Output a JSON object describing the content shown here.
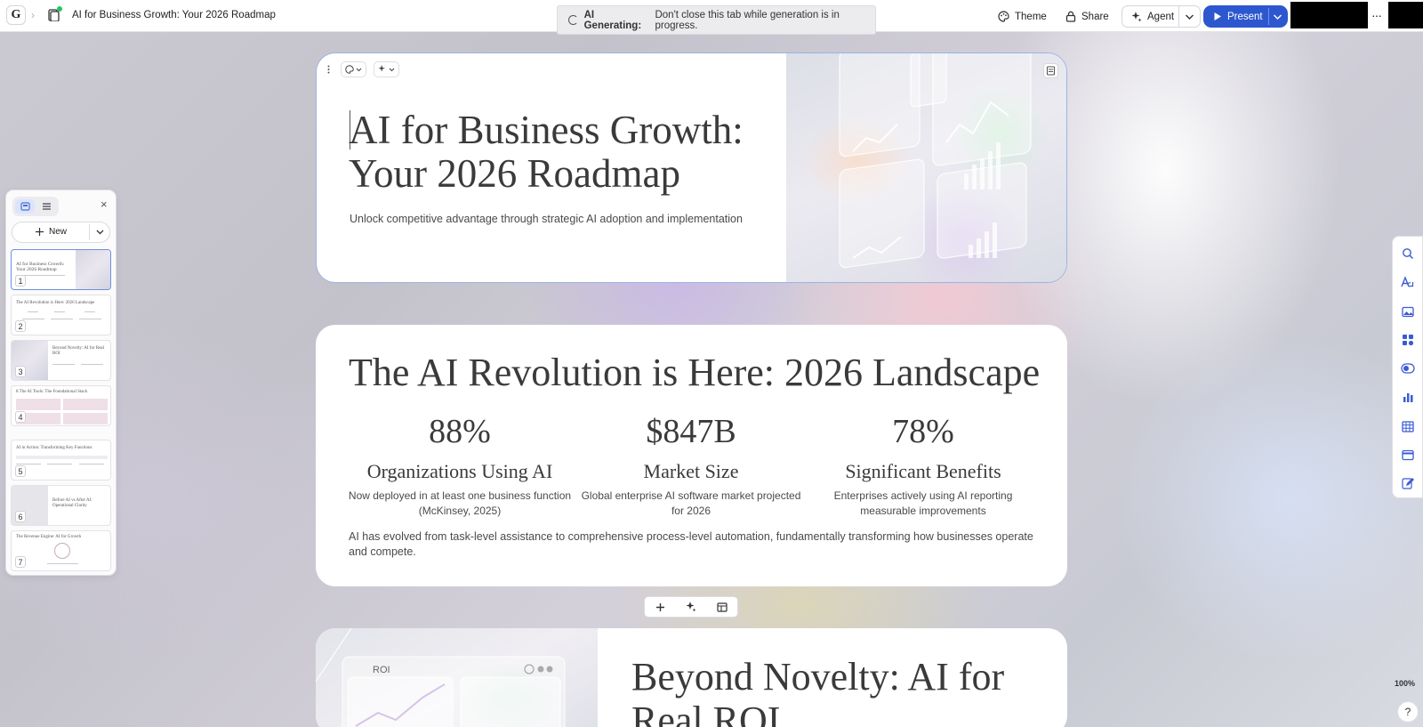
{
  "header": {
    "logo_letter": "G",
    "breadcrumb_sep": "›",
    "doc_title": "AI for Business Growth: Your 2026 Roadmap",
    "banner_bold": "AI Generating:",
    "banner_text": "Don't close this tab while generation is in progress.",
    "theme_label": "Theme",
    "share_label": "Share",
    "agent_label": "Agent",
    "present_label": "Present",
    "more_label": "···"
  },
  "panel": {
    "new_label": "New",
    "close_label": "×",
    "thumbnails": [
      {
        "num": "1",
        "title": "AI for Business Growth: Your 2026 Roadmap"
      },
      {
        "num": "2",
        "title": "The AI Revolution is Here: 2026 Landscape"
      },
      {
        "num": "3",
        "title": "Beyond Novelty: AI for Real ROI"
      },
      {
        "num": "4",
        "title": "8 The AI Tools: The Foundational Stack"
      },
      {
        "num": "5",
        "title": "AI in Action: Transforming Key Functions"
      },
      {
        "num": "6",
        "title": "Before AI vs After AI: Operational Clarity"
      },
      {
        "num": "7",
        "title": "The Revenue Engine: AI for Growth"
      }
    ]
  },
  "slide1": {
    "title": "AI for Business Growth: Your 2026 Roadmap",
    "subtitle": "Unlock competitive advantage through strategic AI adoption and implementation"
  },
  "slide2": {
    "title": "The AI Revolution is Here: 2026 Landscape",
    "stats": [
      {
        "value": "88%",
        "label": "Organizations Using AI",
        "desc": "Now deployed in at least one business function (McKinsey, 2025)"
      },
      {
        "value": "$847B",
        "label": "Market Size",
        "desc": "Global enterprise AI software market projected for 2026"
      },
      {
        "value": "78%",
        "label": "Significant Benefits",
        "desc": "Enterprises actively using AI reporting measurable improvements"
      }
    ],
    "body": "AI has evolved from task-level assistance to comprehensive process-level automation, fundamentally transforming how businesses operate and compete."
  },
  "slide3": {
    "title": "Beyond Novelty: AI for Real ROI",
    "image_label": "ROI"
  },
  "footer": {
    "zoom": "100%",
    "help": "?"
  },
  "colors": {
    "accent": "#2d57cf",
    "selection": "#9db2e6",
    "status_dot": "#22c55e"
  }
}
